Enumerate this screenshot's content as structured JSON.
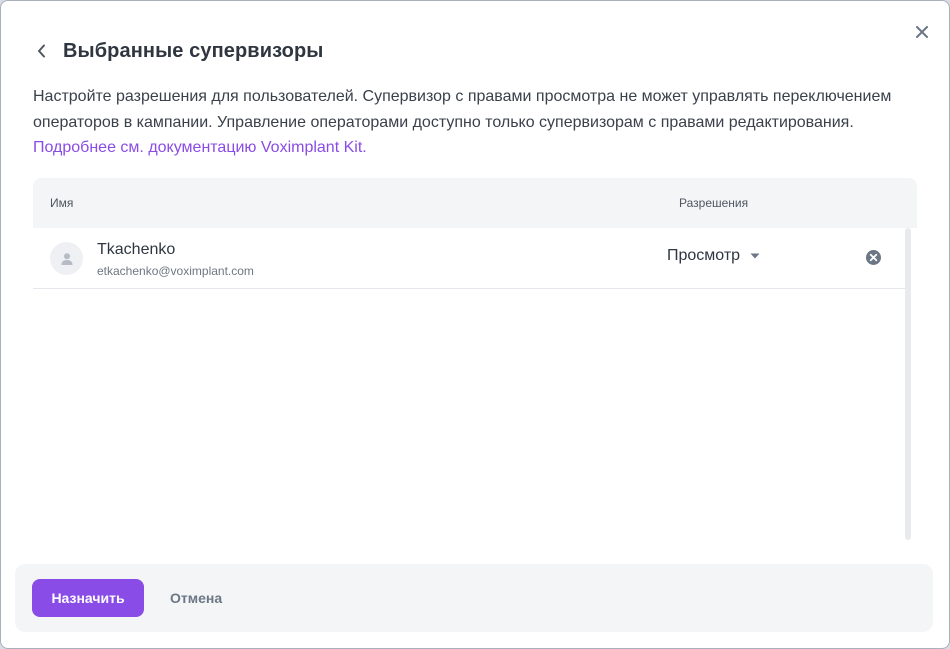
{
  "dialog": {
    "title": "Выбранные супервизоры",
    "close_icon": "close-icon",
    "back_icon": "chevron-left-icon"
  },
  "description": {
    "text": "Настройте разрешения для пользователей. Супервизор с правами просмотра не может управлять переключением операторов в кампании. Управление операторами доступно только супервизорам с правами редактирования. ",
    "link_text": "Подробнее см. документацию Voximplant Kit."
  },
  "table": {
    "columns": {
      "name": "Имя",
      "permissions": "Разрешения"
    },
    "rows": [
      {
        "name": "Tkachenko",
        "email": "etkachenko@voximplant.com",
        "permission": "Просмотр",
        "avatar_icon": "user-placeholder-icon",
        "remove_icon": "remove-circle-icon"
      }
    ]
  },
  "footer": {
    "assign_label": "Назначить",
    "cancel_label": "Отмена"
  },
  "colors": {
    "accent": "#8a4ce6",
    "text": "#2f3640",
    "muted": "#6e7782",
    "panel_bg": "#f4f5f7"
  }
}
